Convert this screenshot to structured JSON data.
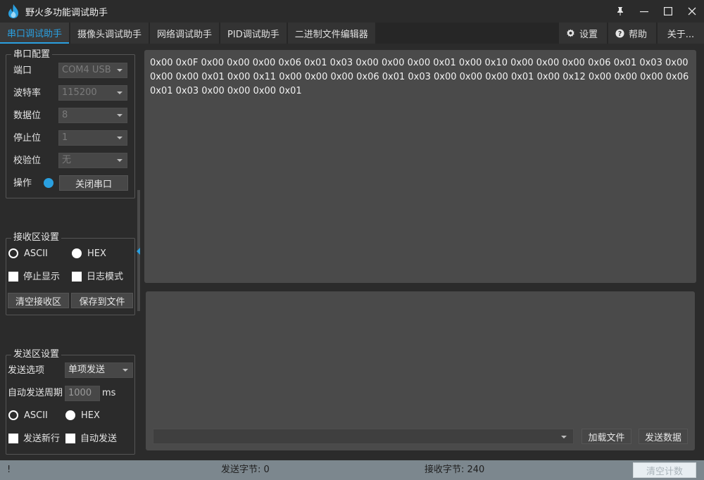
{
  "app": {
    "title": "野火多功能调试助手",
    "logo_icon": "flame-icon",
    "accent_color": "#2aa0e0"
  },
  "window_controls": {
    "pin": "pin-icon",
    "minimize": "minimize-icon",
    "maximize": "maximize-icon",
    "close": "close-icon"
  },
  "tabs": [
    {
      "label": "串口调试助手",
      "active": true
    },
    {
      "label": "摄像头调试助手",
      "active": false
    },
    {
      "label": "网络调试助手",
      "active": false
    },
    {
      "label": "PID调试助手",
      "active": false
    },
    {
      "label": "二进制文件编辑器",
      "active": false
    }
  ],
  "tabs_right": {
    "settings": "设置",
    "help": "帮助",
    "about": "关于..."
  },
  "serial_config": {
    "title": "串口配置",
    "port_label": "端口",
    "port_value": "COM4 USB",
    "baud_label": "波特率",
    "baud_value": "115200",
    "databits_label": "数据位",
    "databits_value": "8",
    "stopbits_label": "停止位",
    "stopbits_value": "1",
    "parity_label": "校验位",
    "parity_value": "无",
    "operation_label": "操作",
    "close_port_button": "关闭串口"
  },
  "receive_settings": {
    "title": "接收区设置",
    "ascii_label": "ASCII",
    "hex_label": "HEX",
    "selected_mode": "HEX",
    "stop_display_label": "停止显示",
    "log_mode_label": "日志模式",
    "clear_button": "清空接收区",
    "save_button": "保存到文件"
  },
  "send_settings": {
    "title": "发送区设置",
    "send_option_label": "发送选项",
    "send_option_value": "单项发送",
    "auto_period_label": "自动发送周期",
    "auto_period_value": "1000",
    "auto_period_unit": "ms",
    "ascii_label": "ASCII",
    "hex_label": "HEX",
    "selected_mode": "HEX",
    "newline_label": "发送新行",
    "auto_send_label": "自动发送"
  },
  "receive_area": {
    "content": "0x00 0x0F 0x00 0x00 0x00 0x06 0x01 0x03 0x00 0x00 0x00 0x01 0x00 0x10 0x00 0x00 0x00 0x06 0x01 0x03 0x00 0x00 0x00 0x01 0x00 0x11 0x00 0x00 0x00 0x06 0x01 0x03 0x00 0x00 0x00 0x01 0x00 0x12 0x00 0x00 0x00 0x06 0x01 0x03 0x00 0x00 0x00 0x01"
  },
  "send_area": {
    "load_file_button": "加载文件",
    "send_data_button": "发送数据"
  },
  "status_bar": {
    "indicator": "!",
    "sent_bytes": "发送字节: 0",
    "received_bytes": "接收字节: 240",
    "clear_count_button": "清空计数"
  }
}
